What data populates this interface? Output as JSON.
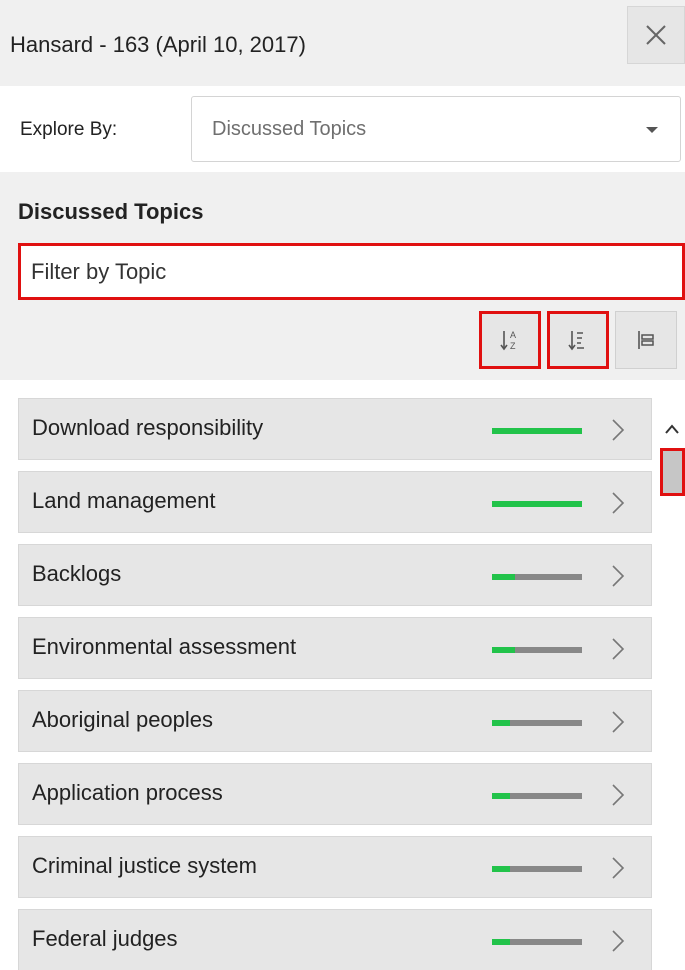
{
  "header": {
    "title": "Hansard - 163 (April 10, 2017)",
    "close_icon": "close-icon"
  },
  "explore": {
    "label": "Explore By:",
    "selected": "Discussed Topics"
  },
  "topics_section": {
    "title": "Discussed Topics",
    "filter_placeholder": "Filter by Topic",
    "sort_buttons": [
      "sort-alpha-icon",
      "sort-frequency-icon",
      "grouping-icon"
    ]
  },
  "colors": {
    "bar_fill": "#22c34a",
    "bar_track": "#888888",
    "highlight": "#e01010"
  },
  "topics": [
    {
      "label": "Download responsibility",
      "level": 1.0
    },
    {
      "label": "Land management",
      "level": 1.0
    },
    {
      "label": "Backlogs",
      "level": 0.25
    },
    {
      "label": "Environmental assessment",
      "level": 0.25
    },
    {
      "label": "Aboriginal peoples",
      "level": 0.2
    },
    {
      "label": "Application process",
      "level": 0.2
    },
    {
      "label": "Criminal justice system",
      "level": 0.2
    },
    {
      "label": "Federal judges",
      "level": 0.2
    }
  ]
}
